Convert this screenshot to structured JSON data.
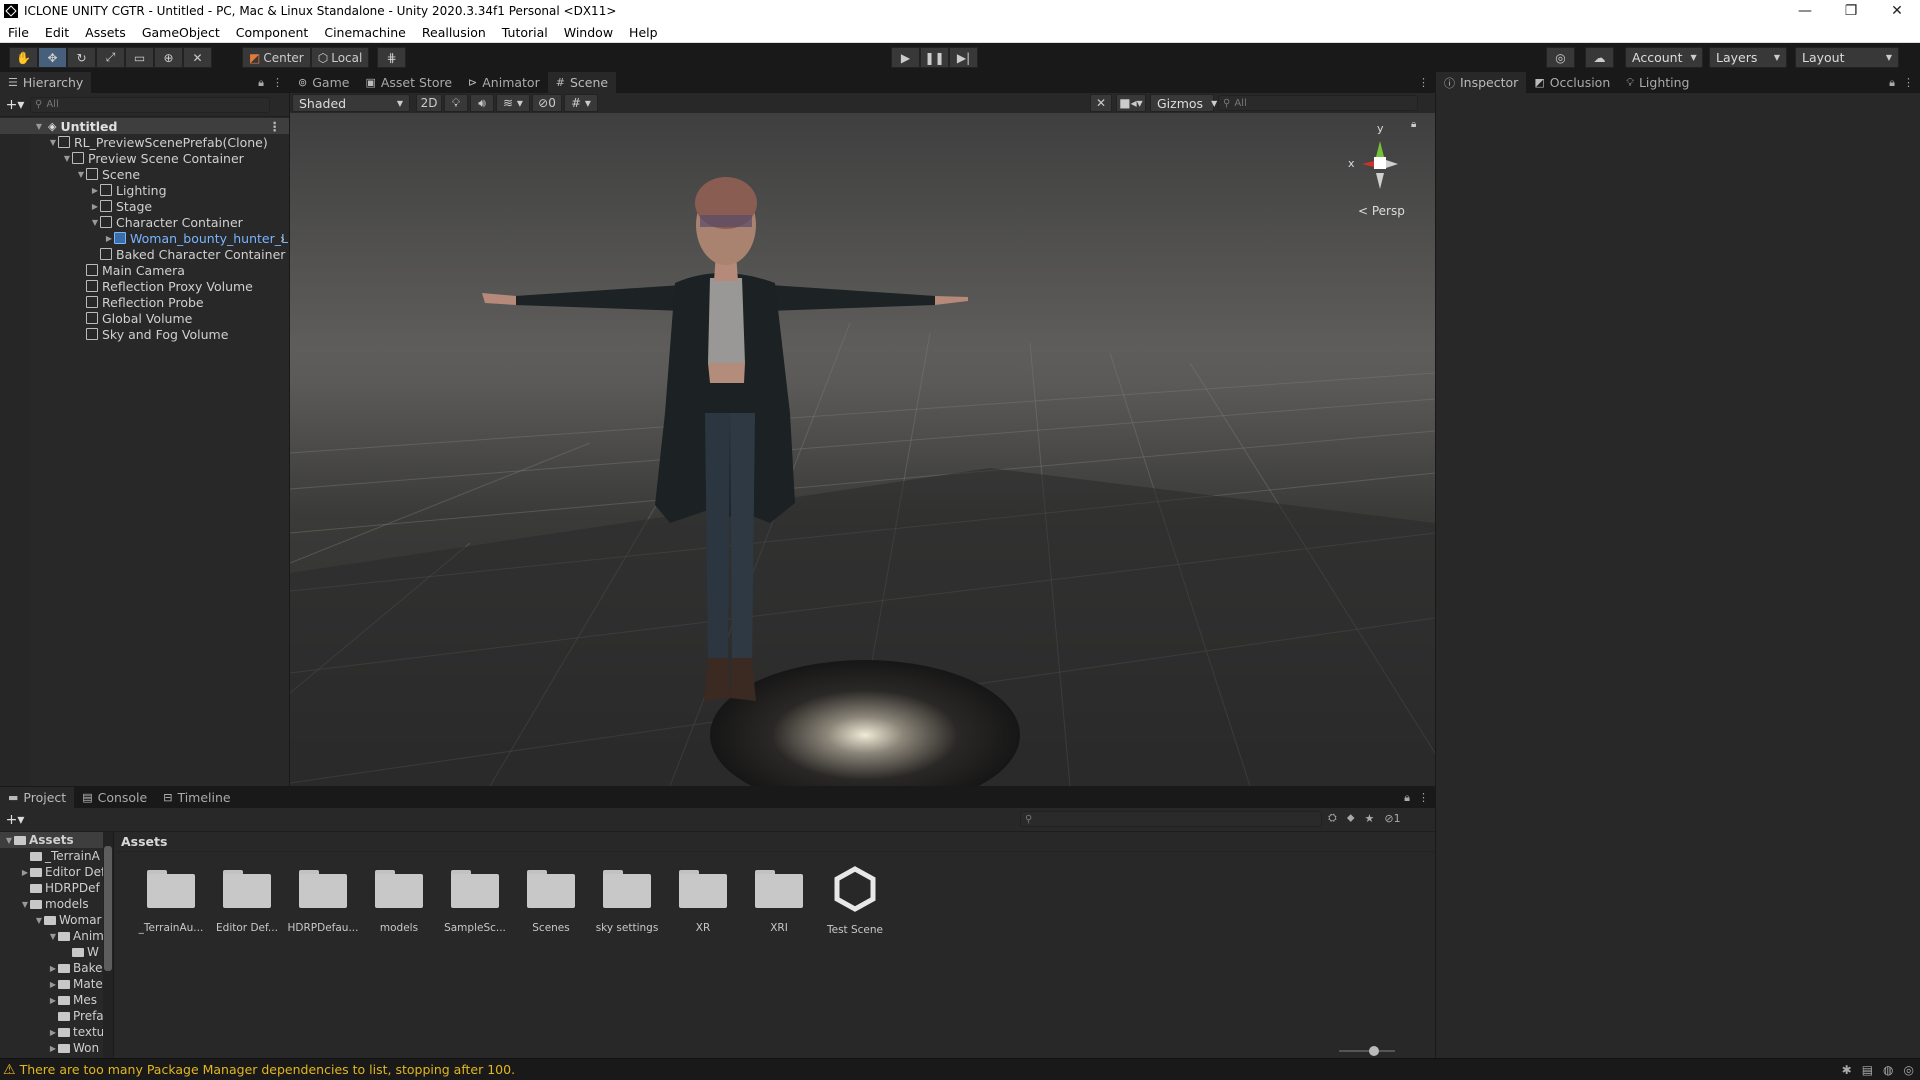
{
  "window": {
    "title": "ICLONE  UNITY CGTR - Untitled - PC, Mac & Linux Standalone - Unity 2020.3.34f1 Personal <DX11>",
    "minimize": "—",
    "maximize": "❐",
    "close": "✕"
  },
  "menu": [
    "File",
    "Edit",
    "Assets",
    "GameObject",
    "Component",
    "Cinemachine",
    "Reallusion",
    "Tutorial",
    "Window",
    "Help"
  ],
  "toolbar": {
    "pivot_center": "Center",
    "pivot_local": "Local",
    "account": "Account",
    "layers": "Layers",
    "layout": "Layout"
  },
  "hierarchy": {
    "tab": "Hierarchy",
    "search_placeholder": "All",
    "scene_name": "Untitled",
    "items": [
      {
        "label": "RL_PreviewScenePrefab(Clone)",
        "depth": 1,
        "fold": "▼"
      },
      {
        "label": "Preview Scene Container",
        "depth": 2,
        "fold": "▼"
      },
      {
        "label": "Scene",
        "depth": 3,
        "fold": "▼"
      },
      {
        "label": "Lighting",
        "depth": 4,
        "fold": "▶"
      },
      {
        "label": "Stage",
        "depth": 4,
        "fold": "▶"
      },
      {
        "label": "Character Container",
        "depth": 4,
        "fold": "▼"
      },
      {
        "label": "Woman_bounty_hunter_L",
        "depth": 5,
        "fold": "▶"
      },
      {
        "label": "Baked Character Container",
        "depth": 4,
        "fold": ""
      },
      {
        "label": "Main Camera",
        "depth": 2,
        "fold": ""
      },
      {
        "label": "Reflection Proxy Volume",
        "depth": 2,
        "fold": ""
      },
      {
        "label": "Reflection Probe",
        "depth": 2,
        "fold": ""
      },
      {
        "label": "Global Volume",
        "depth": 2,
        "fold": ""
      },
      {
        "label": "Sky and Fog Volume",
        "depth": 2,
        "fold": ""
      }
    ]
  },
  "center_tabs": {
    "game": "Game",
    "asset_store": "Asset Store",
    "animator": "Animator",
    "scene": "Scene"
  },
  "scene_toolbar": {
    "shading": "Shaded",
    "mode_2d": "2D",
    "hidden_count": "0",
    "gizmos": "Gizmos",
    "search_placeholder": "All"
  },
  "gizmo": {
    "y": "y",
    "x": "x",
    "projection": "< Persp"
  },
  "inspector_tabs": {
    "inspector": "Inspector",
    "occlusion": "Occlusion",
    "lighting": "Lighting"
  },
  "project": {
    "tabs": {
      "project": "Project",
      "console": "Console",
      "timeline": "Timeline"
    },
    "hidden_count": "1",
    "breadcrumb": "Assets",
    "tree": [
      {
        "label": "Assets",
        "depth": 0,
        "fold": "▼",
        "header": true
      },
      {
        "label": "_TerrainA",
        "depth": 1,
        "fold": ""
      },
      {
        "label": "Editor Def",
        "depth": 1,
        "fold": "▶"
      },
      {
        "label": "HDRPDef",
        "depth": 1,
        "fold": ""
      },
      {
        "label": "models",
        "depth": 1,
        "fold": "▼"
      },
      {
        "label": "Womar",
        "depth": 2,
        "fold": "▼"
      },
      {
        "label": "Anim",
        "depth": 3,
        "fold": "▼"
      },
      {
        "label": "W",
        "depth": 4,
        "fold": ""
      },
      {
        "label": "Bake",
        "depth": 3,
        "fold": "▶"
      },
      {
        "label": "Mate",
        "depth": 3,
        "fold": "▶"
      },
      {
        "label": "Mes",
        "depth": 3,
        "fold": "▶"
      },
      {
        "label": "Prefa",
        "depth": 3,
        "fold": ""
      },
      {
        "label": "textu",
        "depth": 3,
        "fold": "▶"
      },
      {
        "label": "Won",
        "depth": 3,
        "fold": "▶"
      }
    ],
    "assets": [
      {
        "label": "_TerrainAu...",
        "kind": "folder"
      },
      {
        "label": "Editor Def...",
        "kind": "folder"
      },
      {
        "label": "HDRPDefau...",
        "kind": "folder"
      },
      {
        "label": "models",
        "kind": "folder"
      },
      {
        "label": "SampleSc...",
        "kind": "folder"
      },
      {
        "label": "Scenes",
        "kind": "folder"
      },
      {
        "label": "sky settings",
        "kind": "folder"
      },
      {
        "label": "XR",
        "kind": "folder"
      },
      {
        "label": "XRI",
        "kind": "folder"
      },
      {
        "label": "Test Scene",
        "kind": "unity-scene"
      }
    ]
  },
  "status": {
    "message": "There are too many Package Manager dependencies to list, stopping after 100."
  },
  "colors": {
    "accent_blue": "#46607c",
    "selected_text": "#7ab4ff",
    "warning": "#e3b51e"
  }
}
